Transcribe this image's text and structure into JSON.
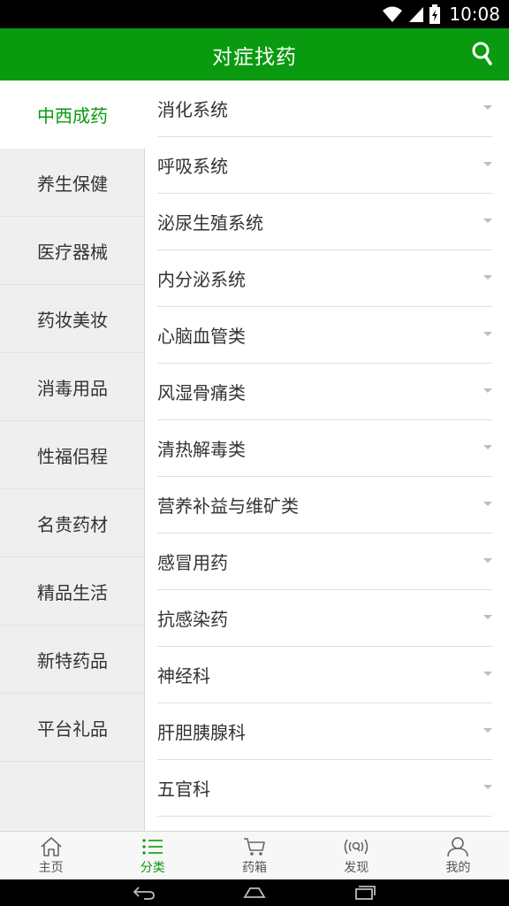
{
  "status_bar": {
    "time": "10:08"
  },
  "header": {
    "title": "对症找药"
  },
  "sidebar": {
    "items": [
      {
        "label": "中西成药",
        "active": true
      },
      {
        "label": "养生保健",
        "active": false
      },
      {
        "label": "医疗器械",
        "active": false
      },
      {
        "label": "药妆美妆",
        "active": false
      },
      {
        "label": "消毒用品",
        "active": false
      },
      {
        "label": "性福侣程",
        "active": false
      },
      {
        "label": "名贵药材",
        "active": false
      },
      {
        "label": "精品生活",
        "active": false
      },
      {
        "label": "新特药品",
        "active": false
      },
      {
        "label": "平台礼品",
        "active": false
      }
    ]
  },
  "categories": [
    "消化系统",
    "呼吸系统",
    "泌尿生殖系统",
    "内分泌系统",
    "心脑血管类",
    "风湿骨痛类",
    "清热解毒类",
    "营养补益与维矿类",
    "感冒用药",
    "抗感染药",
    "神经科",
    "肝胆胰腺科",
    "五官科"
  ],
  "tabbar": {
    "tabs": [
      {
        "label": "主页",
        "icon": "home-icon",
        "active": false
      },
      {
        "label": "分类",
        "icon": "list-icon",
        "active": true
      },
      {
        "label": "药箱",
        "icon": "cart-icon",
        "active": false
      },
      {
        "label": "发现",
        "icon": "discover-icon",
        "active": false
      },
      {
        "label": "我的",
        "icon": "user-icon",
        "active": false
      }
    ]
  },
  "colors": {
    "brand_green": "#0a9a0f",
    "sidebar_bg": "#efefef"
  }
}
